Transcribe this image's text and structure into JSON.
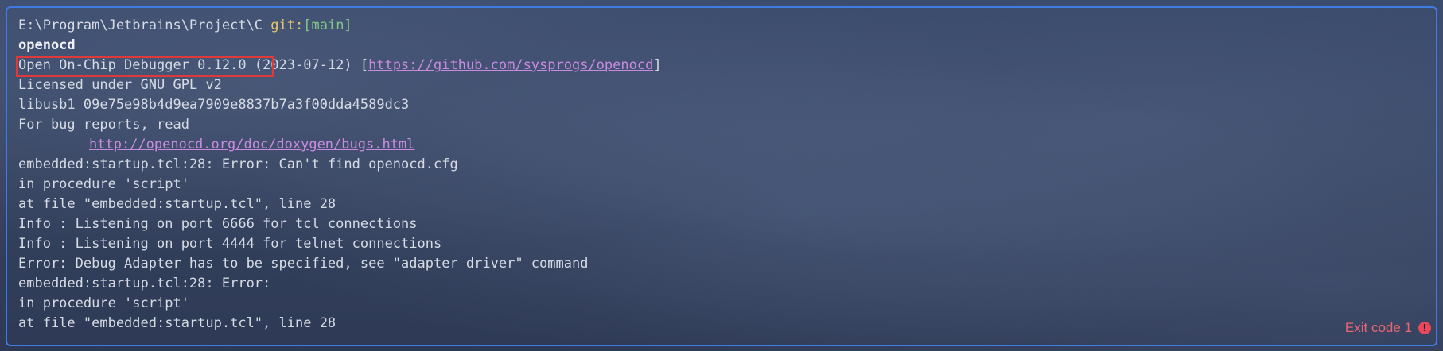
{
  "prompt": {
    "path": "E:\\Program\\Jetbrains\\Project\\C",
    "git_label": "git:",
    "branch": "[main]"
  },
  "command": "openocd",
  "output": {
    "version": "Open On-Chip Debugger 0.12.0",
    "version_date": " (2023-07-12) [",
    "version_url": "https://github.com/sysprogs/openocd",
    "version_close": "]",
    "license": "Licensed under GNU GPL v2",
    "libusb": "libusb1 09e75e98b4d9ea7909e8837b7a3f00dda4589dc3",
    "bug_reports": "For bug reports, read",
    "bug_url": "http://openocd.org/doc/doxygen/bugs.html",
    "error1": "embedded:startup.tcl:28: Error: Can't find openocd.cfg",
    "proc1": "in procedure 'script'",
    "atfile1": "at file \"embedded:startup.tcl\", line 28",
    "info1": "Info : Listening on port 6666 for tcl connections",
    "info2": "Info : Listening on port 4444 for telnet connections",
    "error2": "Error: Debug Adapter has to be specified, see \"adapter driver\" command",
    "error3": "embedded:startup.tcl:28: Error:",
    "proc2": "in procedure 'script'",
    "atfile2": "at file \"embedded:startup.tcl\", line 28"
  },
  "status": {
    "exit_text": "Exit code 1",
    "exit_icon": "!",
    "icon_name": "exclamation-circle-icon"
  },
  "colors": {
    "frame": "#3f7be0",
    "highlight": "#e0393a",
    "exit": "#e96672"
  }
}
